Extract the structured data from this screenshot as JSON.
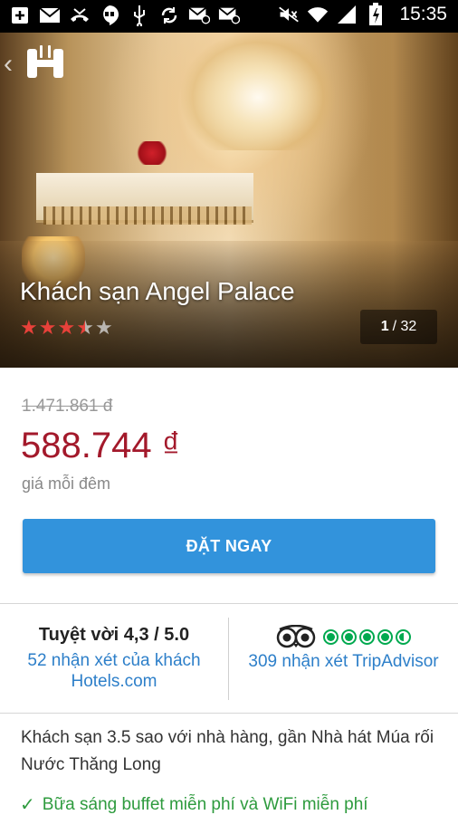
{
  "status_bar": {
    "time": "15:35",
    "left_icons": [
      "add-icon",
      "email-icon",
      "missed-call-icon",
      "hangouts-icon",
      "usb-icon",
      "sync-icon",
      "email-at-icon",
      "email-at-icon"
    ],
    "right_icons": [
      "mute-icon",
      "wifi-icon",
      "signal-icon",
      "battery-charging-icon"
    ]
  },
  "hero": {
    "hotel_name": "Khách sạn Angel Palace",
    "star_rating": 3.5,
    "star_max": 5,
    "photo_index": "1",
    "photo_total": "/ 32"
  },
  "price": {
    "old": "1.471.861 đ",
    "new": "588.744 ₫",
    "per_night": "giá mỗi đêm"
  },
  "booking": {
    "button_label": "ĐẶT NGAY"
  },
  "reviews": {
    "guest_score": "Tuyệt vời 4,3 / 5.0",
    "guest_link": "52 nhận xét của khách Hotels.com",
    "tripadvisor_rating": 4.5,
    "tripadvisor_link": "309 nhận xét TripAdvisor"
  },
  "description": "Khách sạn 3.5 sao với nhà hàng, gần Nhà hát Múa rối Nước Thăng Long",
  "amenities": [
    "Bữa sáng buffet miễn phí và WiFi miễn phí"
  ],
  "colors": {
    "accent_blue": "#3293dc",
    "price_red": "#a3192b",
    "link_blue": "#2d7fc9",
    "star_red": "#e8413a",
    "tripadvisor_green": "#00a94f",
    "amenity_green": "#2e9b3e"
  }
}
